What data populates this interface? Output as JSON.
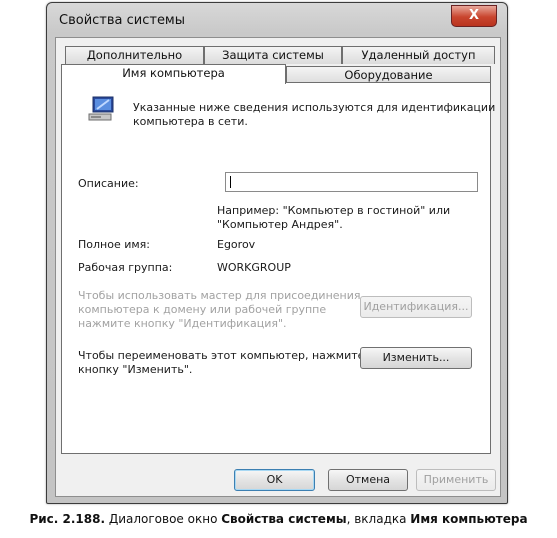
{
  "window": {
    "title": "Свойства системы",
    "close_label": "X"
  },
  "tabs": {
    "row1": [
      "Дополнительно",
      "Защита системы",
      "Удаленный доступ"
    ],
    "row2": [
      "Имя компьютера",
      "Оборудование"
    ]
  },
  "panel": {
    "info_line1": "Указанные ниже сведения используются для идентификации",
    "info_line2": "компьютера в сети.",
    "description_label": "Описание:",
    "description_value": "",
    "example_line1": "Например: \"Компьютер в гостиной\" или",
    "example_line2": "\"Компьютер Андрея\".",
    "fullname_label": "Полное имя:",
    "fullname_value": "Egorov",
    "workgroup_label": "Рабочая группа:",
    "workgroup_value": "WORKGROUP",
    "wizard_line1": "Чтобы использовать мастер для присоединения",
    "wizard_line2": "компьютера к домену или рабочей группе",
    "wizard_line3": "нажмите кнопку \"Идентификация\".",
    "identify_button": "Идентификация...",
    "rename_line1": "Чтобы переименовать этот компьютер, нажмите",
    "rename_line2": "кнопку \"Изменить\".",
    "change_button": "Изменить..."
  },
  "buttons": {
    "ok": "OK",
    "cancel": "Отмена",
    "apply": "Применить"
  },
  "caption": {
    "prefix": "Рис. 2.188.",
    "text1": " Диалоговое окно ",
    "bold1": "Свойства системы",
    "text2": ", вкладка ",
    "bold2": "Имя компьютера"
  }
}
